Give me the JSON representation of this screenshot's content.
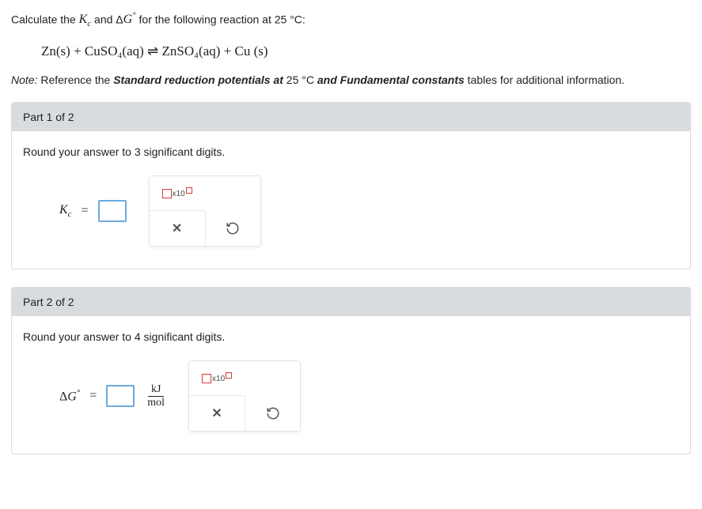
{
  "intro": {
    "prefix": "Calculate the ",
    "k_sym": "K",
    "k_sub": "c",
    "and": " and Δ",
    "g_sym": "G",
    "g_sup": "°",
    "suffix": " for the following reaction at 25 °C:"
  },
  "equation": "Zn(s) + CuSO₄(aq) ⇌ ZnSO₄(aq) + Cu (s)",
  "note": {
    "label": "Note: ",
    "t1": "Reference the ",
    "b1": "Standard reduction potentials at ",
    "mid": "25 °C",
    "b2": " and Fundamental constants",
    "t2": " tables for additional information."
  },
  "parts": [
    {
      "header": "Part 1 of 2",
      "instr": "Round your answer to 3 significant digits.",
      "label": {
        "sym": "K",
        "sub": "c",
        "sup": ""
      },
      "value": "",
      "unit": null
    },
    {
      "header": "Part 2 of 2",
      "instr": "Round your answer to 4 significant digits.",
      "label": {
        "sym": "ΔG",
        "sub": "",
        "sup": "°"
      },
      "value": "",
      "unit": {
        "num": "kJ",
        "den": "mol"
      }
    }
  ],
  "tools": {
    "sci_label": "x10",
    "clear": "✕",
    "reset": "↺"
  }
}
